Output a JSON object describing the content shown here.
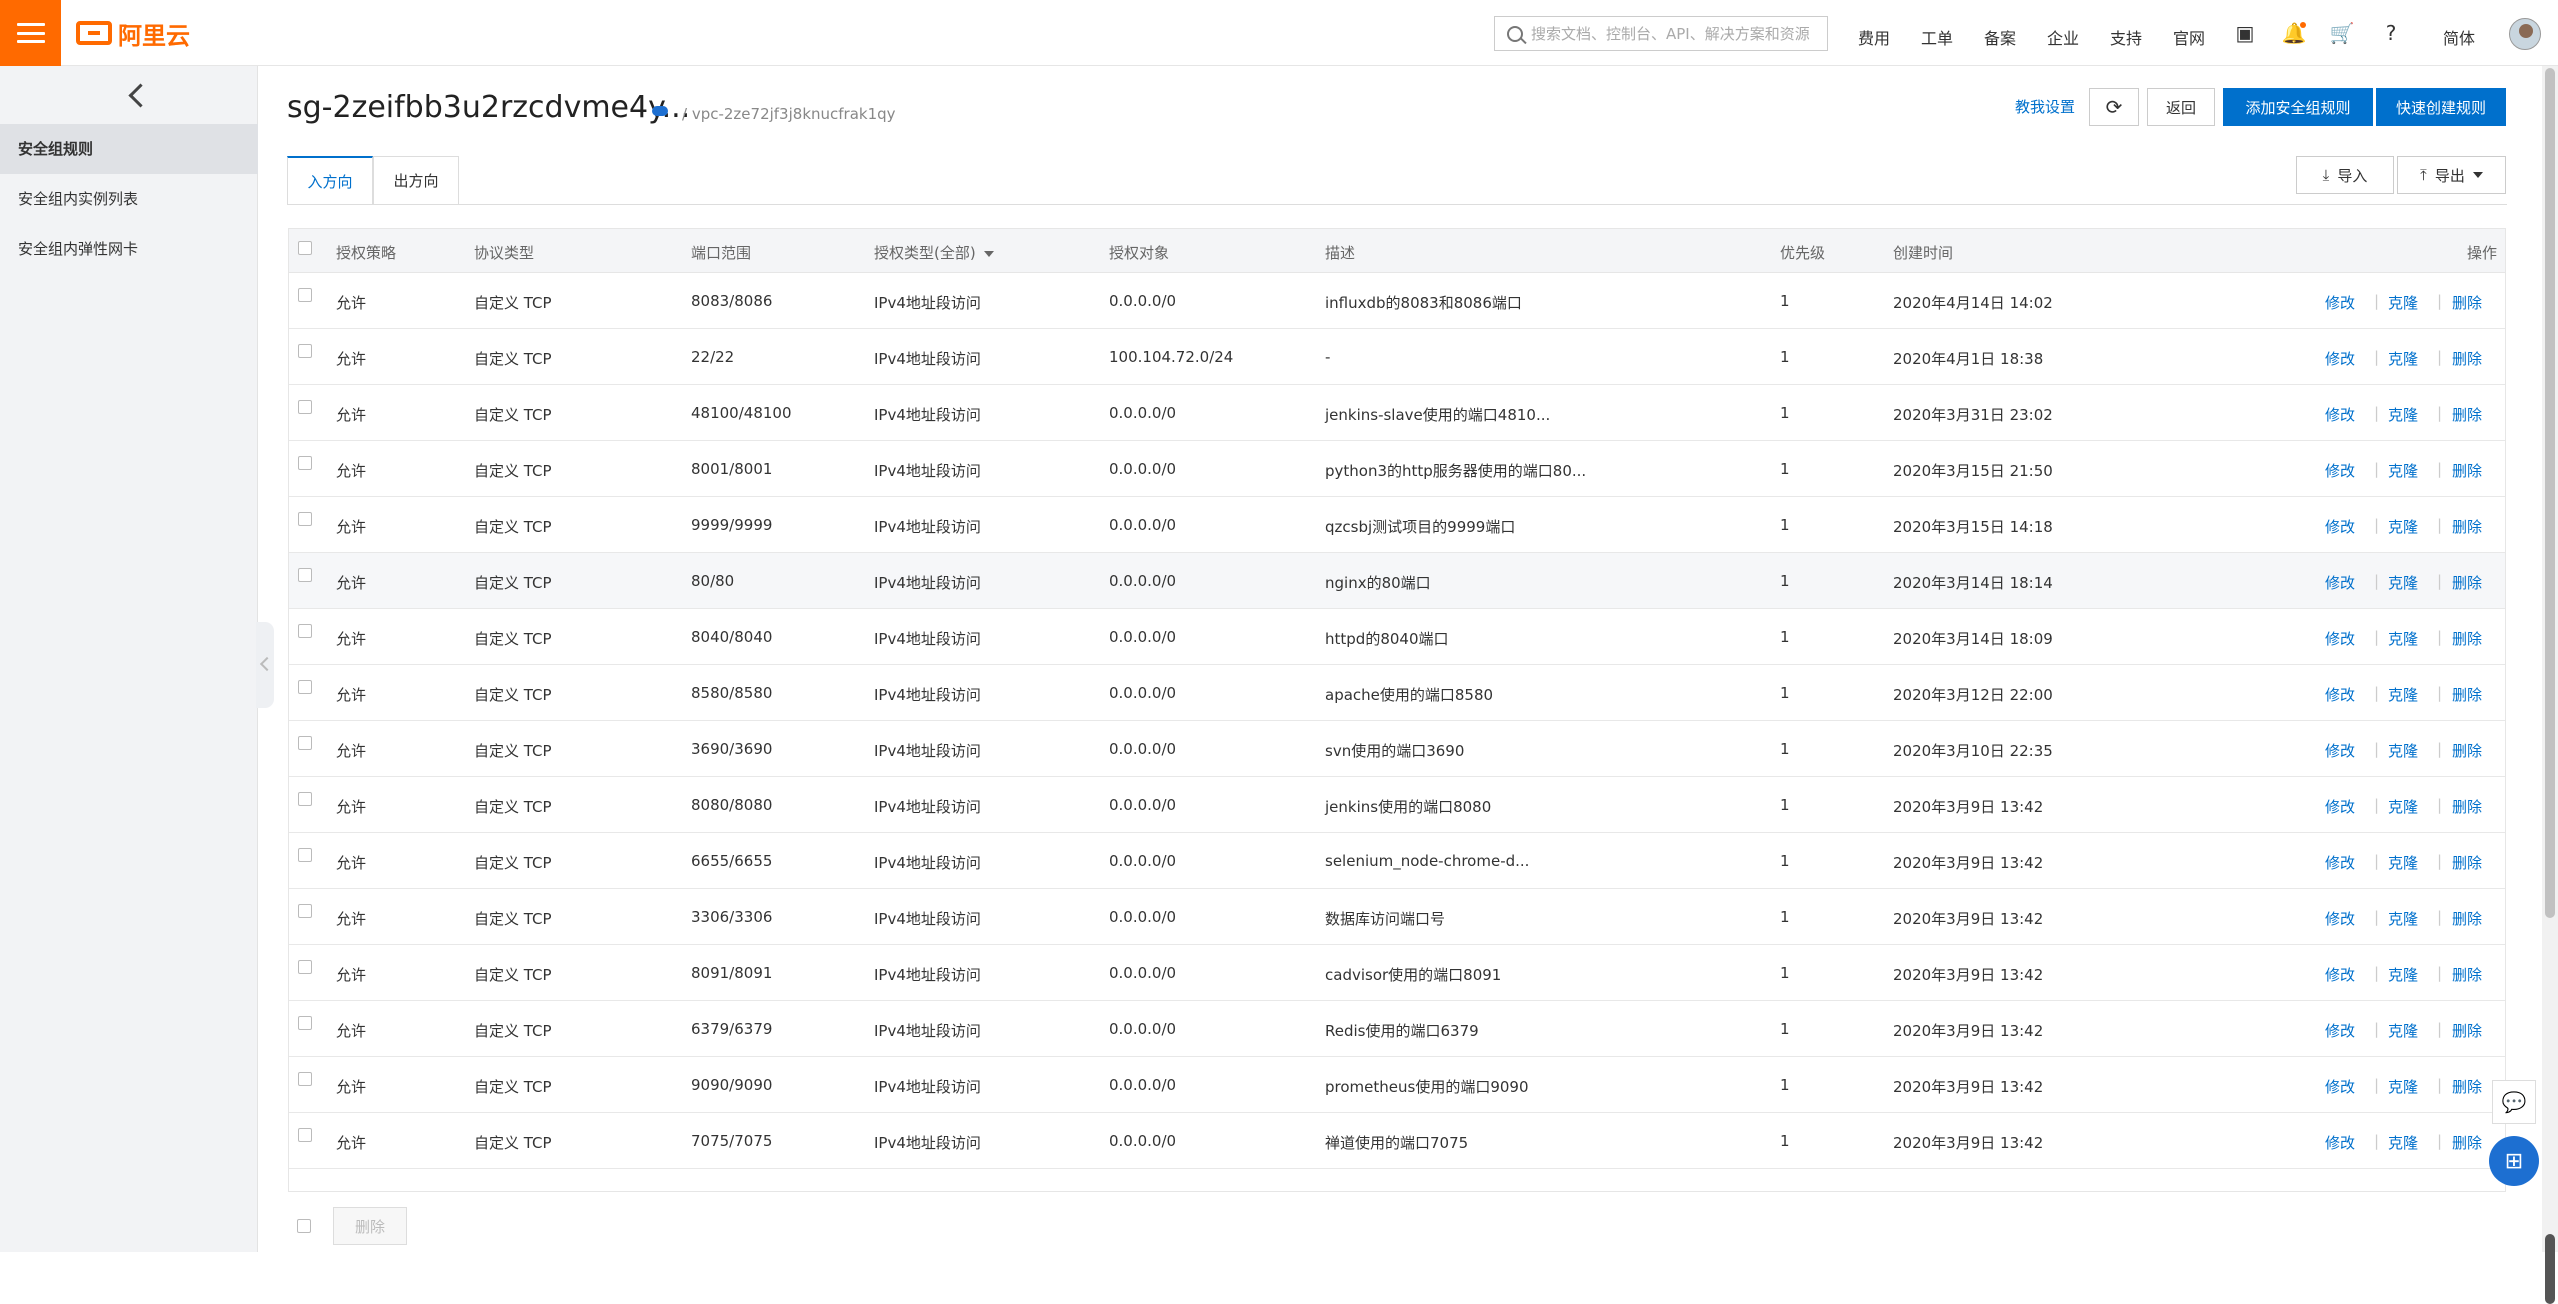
{
  "topbar": {
    "brand": "阿里云",
    "search_placeholder": "搜索文档、控制台、API、解决方案和资源",
    "nav": [
      "费用",
      "工单",
      "备案",
      "企业",
      "支持",
      "官网"
    ],
    "lang": "简体"
  },
  "sidebar": {
    "items": [
      "安全组规则",
      "安全组内实例列表",
      "安全组内弹性网卡"
    ]
  },
  "header": {
    "title": "sg-2zeifbb3u2rzcdvme4y...",
    "vpc": "/ vpc-2ze72jf3j8knucfrak1qy",
    "help": "教我设置",
    "back": "返回",
    "add_rule": "添加安全组规则",
    "quick_rule": "快速创建规则"
  },
  "tabs": [
    "入方向",
    "出方向"
  ],
  "toolbar": {
    "import": "导入",
    "export": "导出"
  },
  "table": {
    "headers": [
      "授权策略",
      "协议类型",
      "端口范围",
      "授权类型(全部)",
      "授权对象",
      "描述",
      "优先级",
      "创建时间",
      "操作"
    ],
    "actions": [
      "修改",
      "克隆",
      "删除"
    ],
    "rows": [
      [
        "允许",
        "自定义 TCP",
        "8083/8086",
        "IPv4地址段访问",
        "0.0.0.0/0",
        "influxdb的8083和8086端口",
        "1",
        "2020年4月14日 14:02"
      ],
      [
        "允许",
        "自定义 TCP",
        "22/22",
        "IPv4地址段访问",
        "100.104.72.0/24",
        "-",
        "1",
        "2020年4月1日 18:38"
      ],
      [
        "允许",
        "自定义 TCP",
        "48100/48100",
        "IPv4地址段访问",
        "0.0.0.0/0",
        "jenkins-slave使用的端口4810...",
        "1",
        "2020年3月31日 23:02"
      ],
      [
        "允许",
        "自定义 TCP",
        "8001/8001",
        "IPv4地址段访问",
        "0.0.0.0/0",
        "python3的http服务器使用的端口80...",
        "1",
        "2020年3月15日 21:50"
      ],
      [
        "允许",
        "自定义 TCP",
        "9999/9999",
        "IPv4地址段访问",
        "0.0.0.0/0",
        "qzcsbj测试项目的9999端口",
        "1",
        "2020年3月15日 14:18"
      ],
      [
        "允许",
        "自定义 TCP",
        "80/80",
        "IPv4地址段访问",
        "0.0.0.0/0",
        "nginx的80端口",
        "1",
        "2020年3月14日 18:14"
      ],
      [
        "允许",
        "自定义 TCP",
        "8040/8040",
        "IPv4地址段访问",
        "0.0.0.0/0",
        "httpd的8040端口",
        "1",
        "2020年3月14日 18:09"
      ],
      [
        "允许",
        "自定义 TCP",
        "8580/8580",
        "IPv4地址段访问",
        "0.0.0.0/0",
        "apache使用的端口8580",
        "1",
        "2020年3月12日 22:00"
      ],
      [
        "允许",
        "自定义 TCP",
        "3690/3690",
        "IPv4地址段访问",
        "0.0.0.0/0",
        "svn使用的端口3690",
        "1",
        "2020年3月10日 22:35"
      ],
      [
        "允许",
        "自定义 TCP",
        "8080/8080",
        "IPv4地址段访问",
        "0.0.0.0/0",
        "jenkins使用的端口8080",
        "1",
        "2020年3月9日 13:42"
      ],
      [
        "允许",
        "自定义 TCP",
        "6655/6655",
        "IPv4地址段访问",
        "0.0.0.0/0",
        "selenium_node-chrome-d...",
        "1",
        "2020年3月9日 13:42"
      ],
      [
        "允许",
        "自定义 TCP",
        "3306/3306",
        "IPv4地址段访问",
        "0.0.0.0/0",
        "数据库访问端口号",
        "1",
        "2020年3月9日 13:42"
      ],
      [
        "允许",
        "自定义 TCP",
        "8091/8091",
        "IPv4地址段访问",
        "0.0.0.0/0",
        "cadvisor使用的端口8091",
        "1",
        "2020年3月9日 13:42"
      ],
      [
        "允许",
        "自定义 TCP",
        "6379/6379",
        "IPv4地址段访问",
        "0.0.0.0/0",
        "Redis使用的端口6379",
        "1",
        "2020年3月9日 13:42"
      ],
      [
        "允许",
        "自定义 TCP",
        "9090/9090",
        "IPv4地址段访问",
        "0.0.0.0/0",
        "prometheus使用的端口9090",
        "1",
        "2020年3月9日 13:42"
      ],
      [
        "允许",
        "自定义 TCP",
        "7075/7075",
        "IPv4地址段访问",
        "0.0.0.0/0",
        "禅道使用的端口7075",
        "1",
        "2020年3月9日 13:42"
      ]
    ]
  },
  "footer": {
    "delete": "删除"
  },
  "colors": {
    "brand": "#ff6a00",
    "primary": "#0070cc"
  },
  "icons": [
    "menu-icon",
    "search-icon",
    "terminal-icon",
    "bell-icon",
    "cart-icon",
    "help-icon",
    "refresh-icon",
    "download-icon",
    "upload-icon",
    "chat-icon",
    "apps-icon"
  ]
}
